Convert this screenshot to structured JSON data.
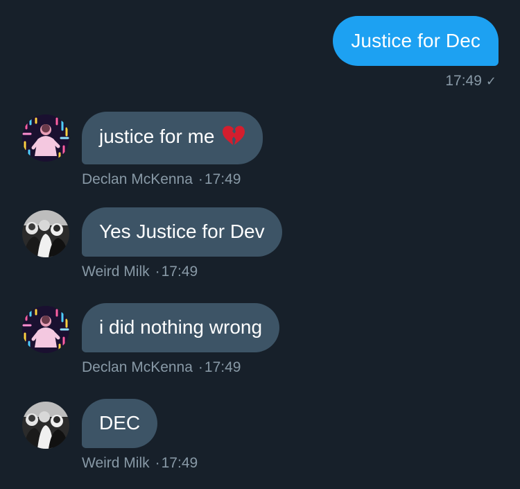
{
  "messages": [
    {
      "direction": "outgoing",
      "text": "Justice for Dec",
      "time": "17:49",
      "status_icon": "sent-check-icon",
      "status_glyph": "✓"
    },
    {
      "direction": "incoming",
      "text": "justice for me",
      "emoji": "broken-heart-icon",
      "sender": "Declan McKenna",
      "separator": "·",
      "time": "17:49"
    },
    {
      "direction": "incoming",
      "text": "Yes Justice for Dev",
      "sender": "Weird Milk",
      "separator": "·",
      "time": "17:49"
    },
    {
      "direction": "incoming",
      "text": "i did nothing wrong",
      "sender": "Declan McKenna",
      "separator": "·",
      "time": "17:49"
    },
    {
      "direction": "incoming",
      "text": "DEC",
      "sender": "Weird Milk",
      "separator": "·",
      "time": "17:49"
    }
  ],
  "colors": {
    "background": "#17202a",
    "outgoing_bubble": "#1da1f2",
    "incoming_bubble": "#3d5466",
    "meta_text": "#8899a6"
  }
}
